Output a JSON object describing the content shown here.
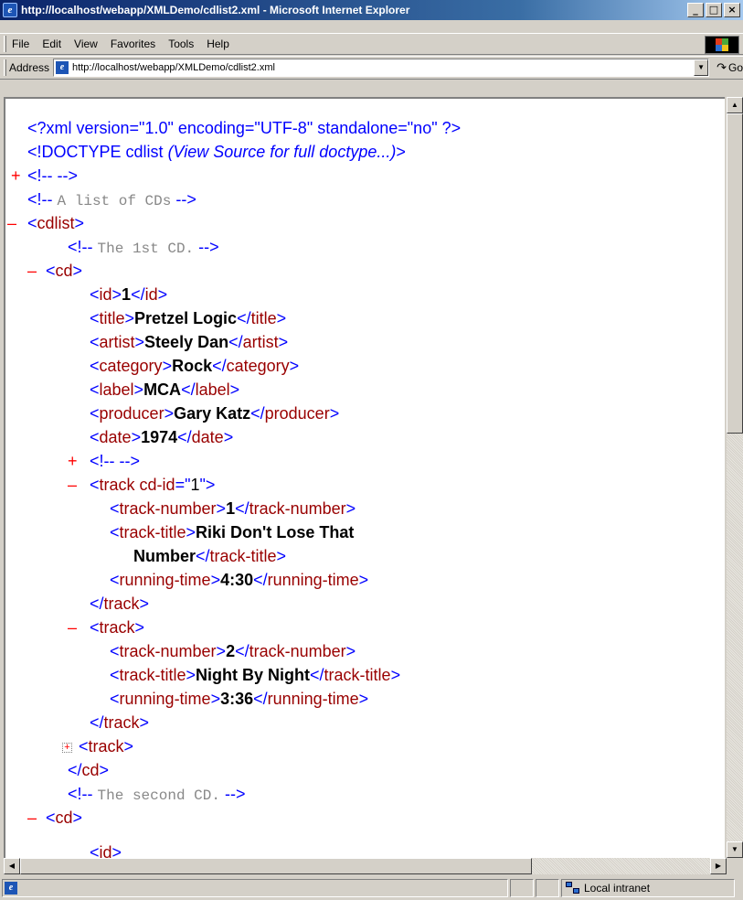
{
  "window": {
    "title": "http://localhost/webapp/XMLDemo/cdlist2.xml - Microsoft Internet Explorer",
    "buttons": {
      "minimize": "_",
      "maximize": "□",
      "close": "×"
    }
  },
  "menu": {
    "items": [
      "File",
      "Edit",
      "View",
      "Favorites",
      "Tools",
      "Help"
    ]
  },
  "address": {
    "label": "Address",
    "url": "http://localhost/webapp/XMLDemo/cdlist2.xml",
    "go_label": "Go"
  },
  "xml": {
    "prolog": "<?xml version=\"1.0\" encoding=\"UTF-8\" standalone=\"no\" ?>",
    "doctype_prefix": "<!DOCTYPE cdlist",
    "doctype_note": "(View Source for full doctype...)",
    "doctype_suffix": ">",
    "collapsed_comment": "<!--   -->",
    "comment_list": "A list of CDs",
    "comment_first": "The 1st CD.",
    "comment_second": "The second CD.",
    "cd1": {
      "id": "1",
      "title": "Pretzel Logic",
      "artist": "Steely Dan",
      "category": "Rock",
      "label": "MCA",
      "producer": "Gary Katz",
      "date": "1974"
    },
    "track1": {
      "attr_name": "cd-id",
      "attr_value": "1",
      "number": "1",
      "title_part1": "Riki Don't Lose That",
      "title_part2": "Number",
      "running_time": "4:30"
    },
    "track2": {
      "number": "2",
      "title": "Night By Night",
      "running_time": "3:36"
    }
  },
  "status": {
    "zone": "Local intranet"
  }
}
